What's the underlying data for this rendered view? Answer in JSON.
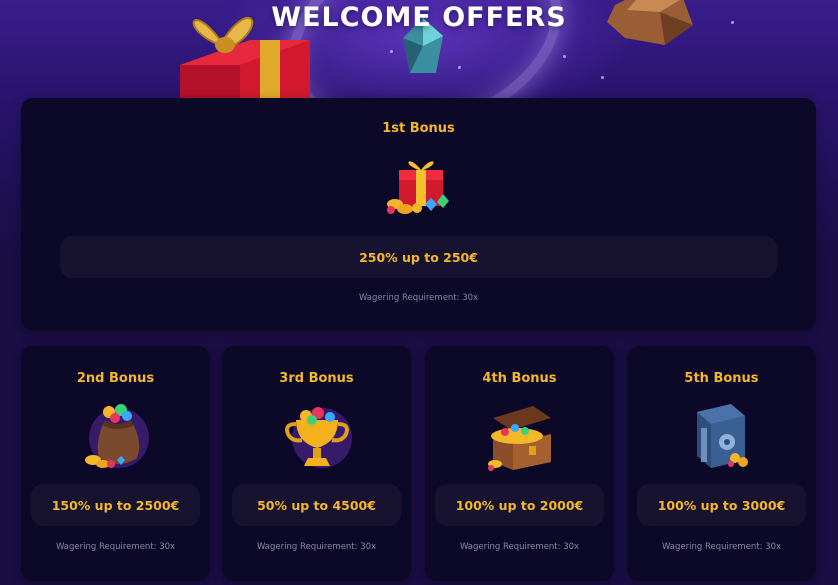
{
  "page": {
    "title": "WELCOME OFFERS"
  },
  "colors": {
    "accent": "#f5b72a",
    "card_bg": "#0c0828",
    "pill_bg": "#16122f",
    "muted_text": "#8c86a3"
  },
  "bonuses": [
    {
      "title": "1st Bonus",
      "offer": "250% up to 250€",
      "wagering": "Wagering Requirement: 30x",
      "icon": "gift-box-icon"
    },
    {
      "title": "2nd Bonus",
      "offer": "150% up to 2500€",
      "wagering": "Wagering Requirement: 30x",
      "icon": "coin-bag-icon"
    },
    {
      "title": "3rd Bonus",
      "offer": "50% up to 4500€",
      "wagering": "Wagering Requirement: 30x",
      "icon": "trophy-icon"
    },
    {
      "title": "4th Bonus",
      "offer": "100% up to 2000€",
      "wagering": "Wagering Requirement: 30x",
      "icon": "treasure-chest-icon"
    },
    {
      "title": "5th Bonus",
      "offer": "100% up to 3000€",
      "wagering": "Wagering Requirement: 30x",
      "icon": "safe-icon"
    }
  ]
}
